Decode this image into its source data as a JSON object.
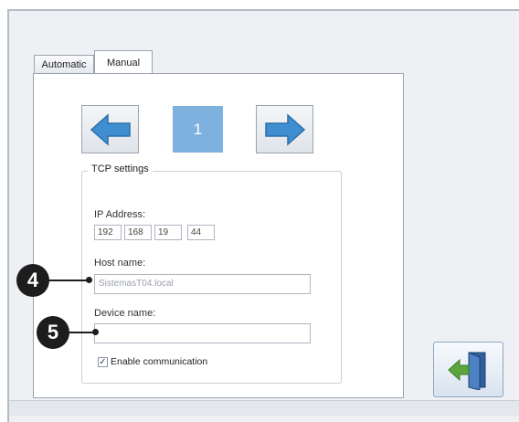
{
  "tabs": [
    {
      "label": "Automatic",
      "active": false
    },
    {
      "label": "Manual",
      "active": true
    }
  ],
  "nav": {
    "prev_icon": "arrow-left-icon",
    "next_icon": "arrow-right-icon",
    "page_number": "1"
  },
  "tcp": {
    "group_title": "TCP settings",
    "ip_label": "IP Address:",
    "ip": [
      "192",
      "168",
      "19",
      "44"
    ],
    "host_label": "Host name:",
    "host_value": "SistemasT04.local",
    "device_label": "Device name:",
    "device_value": "",
    "enable_label": "Enable communication",
    "enable_checked": true
  },
  "exit_button": {
    "icon": "exit-door-icon"
  },
  "callouts": [
    "4",
    "5"
  ],
  "colors": {
    "arrow_blue": "#3f8fd0",
    "page_box": "#7fb1de",
    "door_green": "#5aa53c"
  }
}
